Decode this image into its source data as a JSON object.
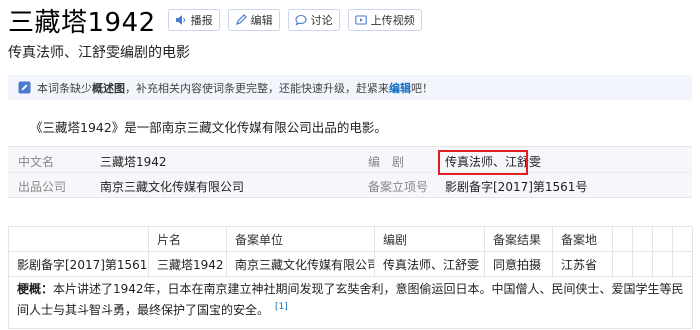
{
  "header": {
    "title": "三藏塔1942",
    "actions": [
      {
        "label": "播报",
        "icon": "speaker-icon"
      },
      {
        "label": "编辑",
        "icon": "edit-icon"
      },
      {
        "label": "讨论",
        "icon": "chat-icon"
      },
      {
        "label": "上传视频",
        "icon": "video-icon"
      }
    ]
  },
  "subtitle": "传真法师、江舒雯编剧的电影",
  "notice": {
    "prefix": "本词条缺少",
    "bold": "概述图",
    "middle": "，补充相关内容使词条更完整，还能快速升级，赶紧来",
    "link": "编辑",
    "suffix": "吧！"
  },
  "summary": "《三藏塔1942》是一部南京三藏文化传媒有限公司出品的电影。",
  "info": {
    "chinese_name_label": "中文名",
    "chinese_name_value": "三藏塔1942",
    "screenwriter_label": "编　剧",
    "screenwriter_value": "传真法师、江舒雯",
    "producer_label": "出品公司",
    "producer_value": "南京三藏文化传媒有限公司",
    "record_label": "备案立项号",
    "record_value": "影剧备字[2017]第1561号"
  },
  "table": {
    "headers": [
      "",
      "片名",
      "备案单位",
      "编剧",
      "备案结果",
      "备案地"
    ],
    "row": [
      "影剧备字[2017]第1561号",
      "三藏塔1942",
      "南京三藏文化传媒有限公司",
      "传真法师、江舒雯",
      "同意拍摄",
      "江苏省"
    ],
    "plot_label": "梗概：",
    "plot_text": "本片讲述了1942年，日本在南京建立神社期间发现了玄奘舍利，意图偷运回日本。中国僧人、民间侠士、爱国学生等民间人士与其斗智斗勇，最终保护了国宝的安全。",
    "ref": "[1]"
  }
}
